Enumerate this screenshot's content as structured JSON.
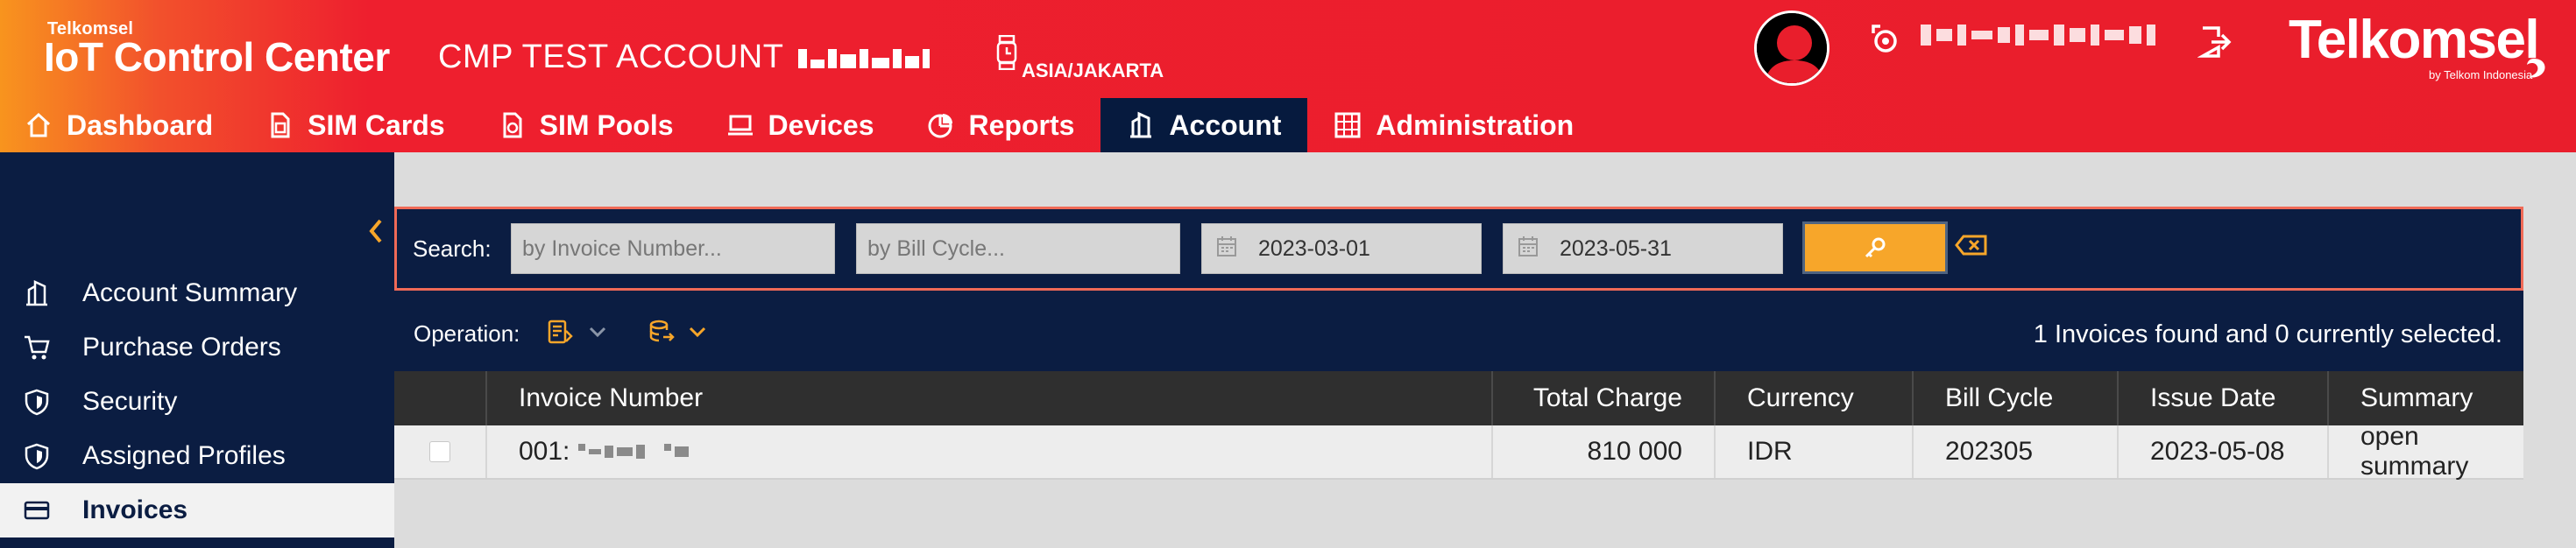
{
  "header": {
    "brand_small": "Telkomsel",
    "brand_main": "IoT Control Center",
    "account_name": "CMP TEST ACCOUNT",
    "timezone": "ASIA/JAKARTA",
    "logo_text": "Telkomsel",
    "logo_sub": "by Telkom Indonesia"
  },
  "nav": {
    "items": [
      {
        "label": "Dashboard",
        "icon": "home-icon"
      },
      {
        "label": "SIM Cards",
        "icon": "sim-card-icon"
      },
      {
        "label": "SIM Pools",
        "icon": "sim-pool-icon"
      },
      {
        "label": "Devices",
        "icon": "laptop-icon"
      },
      {
        "label": "Reports",
        "icon": "pie-chart-icon"
      },
      {
        "label": "Account",
        "icon": "building-icon"
      },
      {
        "label": "Administration",
        "icon": "admin-grid-icon"
      }
    ],
    "active": "Account"
  },
  "sidebar": {
    "items": [
      {
        "label": "Account Summary",
        "icon": "building-icon"
      },
      {
        "label": "Purchase Orders",
        "icon": "cart-icon"
      },
      {
        "label": "Security",
        "icon": "shield-icon"
      },
      {
        "label": "Assigned Profiles",
        "icon": "shield-icon"
      },
      {
        "label": "Invoices",
        "icon": "invoice-card-icon"
      }
    ],
    "active": "Invoices"
  },
  "search": {
    "label": "Search:",
    "invoice_placeholder": "by Invoice Number...",
    "bill_cycle_placeholder": "by Bill Cycle...",
    "date_from": "2023-03-01",
    "date_to": "2023-05-31"
  },
  "operations": {
    "label": "Operation:",
    "found_text": "1 Invoices found and 0 currently selected."
  },
  "table": {
    "columns": [
      "Invoice Number",
      "Total Charge",
      "Currency",
      "Bill Cycle",
      "Issue Date",
      "Summary"
    ],
    "rows": [
      {
        "invoice_number": "001:",
        "total_charge": "810 000",
        "currency": "IDR",
        "bill_cycle": "202305",
        "issue_date": "2023-05-08",
        "summary": "open summary"
      }
    ]
  },
  "colors": {
    "header_red": "#e91e2c",
    "header_orange": "#f8941e",
    "navy": "#0b1d42",
    "active_nav": "#061a3e",
    "search_button": "#f7a62a"
  }
}
